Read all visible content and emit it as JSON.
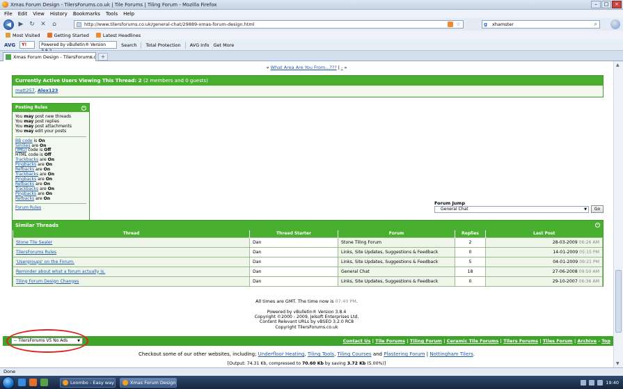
{
  "window": {
    "title": "Xmas Forum Design - TilersForums.co.uk | Tile Forums | Tiling Forum - Mozilla Firefox"
  },
  "menu": [
    "File",
    "Edit",
    "View",
    "History",
    "Bookmarks",
    "Tools",
    "Help"
  ],
  "nav": {
    "url": "http://www.tilersforums.co.uk/general-chat/29889-xmas-forum-design.html",
    "search_value": "xhamster"
  },
  "bookmarks": [
    "Most Visited",
    "Getting Started",
    "Latest Headlines"
  ],
  "toolbar": {
    "avg": "AVG",
    "y_label": "Y!",
    "powered": "Powered by vBulletin® Version 3.8.2",
    "search": "Search",
    "total_protection": "Total Protection",
    "avg_info": "AVG Info",
    "get_more": "Get More"
  },
  "tab": {
    "label": "Xmas Forum Design - TilersForums.c..."
  },
  "prevnext": {
    "prev": "«",
    "link": "What Area Are You From...???",
    "sep": "|",
    "dash": "-",
    "next": "»"
  },
  "active_users": {
    "title": "Currently Active Users Viewing This Thread: 2",
    "detail": "(2 members and 0 guests)",
    "users": [
      "matt257",
      "Alex123"
    ]
  },
  "posting_rules": {
    "title": "Posting Rules",
    "permissions": [
      {
        "pre": "You ",
        "bold": "may",
        "post": " post new threads"
      },
      {
        "pre": "You ",
        "bold": "may",
        "post": " post replies"
      },
      {
        "pre": "You ",
        "bold": "may",
        "post": " post attachments"
      },
      {
        "pre": "You ",
        "bold": "may",
        "post": " edit your posts"
      }
    ],
    "codes": [
      {
        "name": "BB code",
        "verb": " is ",
        "state": "On",
        "link": true
      },
      {
        "name": "Smilies",
        "verb": " are ",
        "state": "On",
        "link": true
      },
      {
        "name": "[IMG]",
        "verb": " code is ",
        "state": "Off",
        "link": true
      },
      {
        "name": "HTML code",
        "verb": " is ",
        "state": "Off",
        "link": false
      },
      {
        "name": "Trackbacks",
        "verb": " are ",
        "state": "On",
        "link": true
      },
      {
        "name": "Pingbacks",
        "verb": " are ",
        "state": "On",
        "link": true
      },
      {
        "name": "Refbacks",
        "verb": " are ",
        "state": "On",
        "link": true
      },
      {
        "name": "Trackbacks",
        "verb": " are ",
        "state": "On",
        "link": true
      },
      {
        "name": "Pingbacks",
        "verb": " are ",
        "state": "On",
        "link": true
      },
      {
        "name": "Refbacks",
        "verb": " are ",
        "state": "On",
        "link": true
      },
      {
        "name": "Trackbacks",
        "verb": " are ",
        "state": "On",
        "link": true
      },
      {
        "name": "Pingbacks",
        "verb": " are ",
        "state": "On",
        "link": true
      },
      {
        "name": "Refbacks",
        "verb": " are ",
        "state": "On",
        "link": true
      }
    ],
    "forum_rules": "Forum Rules"
  },
  "forum_jump": {
    "label": "Forum Jump",
    "selected": "General Chat",
    "go": "Go"
  },
  "similar_threads": {
    "title": "Similar Threads",
    "columns": [
      "Thread",
      "Thread Starter",
      "Forum",
      "Replies",
      "Last Post"
    ],
    "rows": [
      {
        "thread": "Stone Tile Sealer",
        "starter": "Dan",
        "forum": "Stone Tiling Forum",
        "replies": "2",
        "date": "28-03-2009",
        "time": "06:26 AM"
      },
      {
        "thread": "TilersForums Rules",
        "starter": "Dan",
        "forum": "Links, Site Updates, Suggestions & Feedback",
        "replies": "0",
        "date": "14-01-2009",
        "time": "05:15 PM"
      },
      {
        "thread": "'Usergroups' on the Forum.",
        "starter": "Dan",
        "forum": "Links, Site Updates, Suggestions & Feedback",
        "replies": "5",
        "date": "04-01-2009",
        "time": "09:21 PM"
      },
      {
        "thread": "Reminder about what a forum actually is.",
        "starter": "Dan",
        "forum": "General Chat",
        "replies": "18",
        "date": "27-06-2008",
        "time": "09:50 AM"
      },
      {
        "thread": "Tiling Forum Design Changes",
        "starter": "Dan",
        "forum": "Links, Site Updates, Suggestions & Feedback",
        "replies": "0",
        "date": "29-10-2007",
        "time": "06:36 AM"
      }
    ]
  },
  "times": {
    "pre": "All times are GMT. The time now is ",
    "time": "07:40 PM",
    "post": "."
  },
  "credits": [
    "Powered by vBulletin® Version 3.8.4",
    "Copyright ©2000 - 2009, Jelsoft Enterprises Ltd.",
    "Content Relevant URLs by vBSEO 3.2.0 RC8",
    "Copyright TilersForums.co.uk"
  ],
  "footer": {
    "style_selected": "-- TilersForums V5 No Ads",
    "links": [
      "Contact Us",
      "Tile Forums",
      "Tiling Forum",
      "Ceramic Tile Forums",
      "Tilers Forums",
      "Tiles Forum",
      "Archive",
      "Top"
    ]
  },
  "other_sites": {
    "pre": "Checkout some of our other websites, including; ",
    "sites": [
      "Underfloor Heating",
      "Tiling Tools",
      "Tiling Courses",
      "Plastering Forum",
      "Nottingham Tilers"
    ],
    "and": " and ",
    "end": "."
  },
  "output": {
    "pre": "[Output: 74.31 Kb, compressed to ",
    "compressed": "70.60 Kb",
    "mid": " by saving ",
    "saved": "3.72 Kb",
    "post": " (5.00%)]"
  },
  "status": "Done",
  "taskbar": {
    "tasks": [
      "Loombo - Easy way ...",
      "Xmas Forum Design..."
    ],
    "clock": "19:40"
  }
}
